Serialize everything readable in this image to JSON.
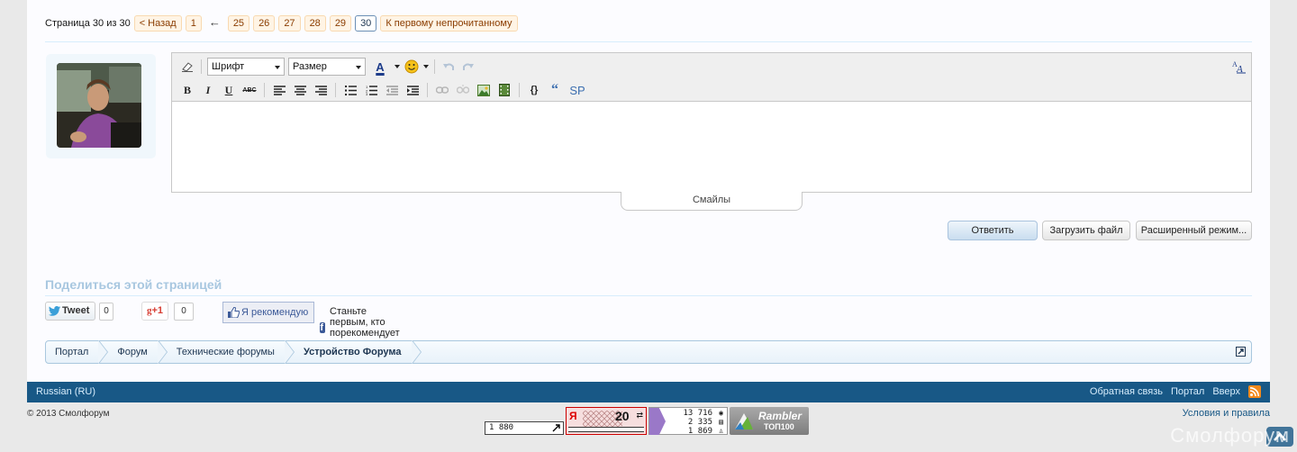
{
  "pagination": {
    "label": "Страница 30 из 30",
    "prev": "< Назад",
    "first": "1",
    "ellipsis_arrow": "←",
    "pages": [
      "25",
      "26",
      "27",
      "28",
      "29"
    ],
    "current": "30",
    "first_unread": "К первому непрочитанному"
  },
  "editor": {
    "font_select": "Шрифт",
    "size_select": "Размер",
    "text_color_letter": "A",
    "bold": "B",
    "italic": "I",
    "underline": "U",
    "strike": "ABC",
    "code_icon": "{}",
    "quote_icon": "“",
    "spoiler": "SP",
    "smilies_tab": "Смайлы"
  },
  "buttons": {
    "reply": "Ответить",
    "upload": "Загрузить файл",
    "advanced": "Расширенный режим..."
  },
  "share": {
    "title": "Поделиться этой страницей",
    "tweet": "Tweet",
    "tweet_count": "0",
    "gplus": "+1",
    "gplus_count": "0",
    "fb_recommend": "Я рекомендую",
    "fb_text": "Станьте первым, кто порекомендует это."
  },
  "breadcrumbs": [
    "Портал",
    "Форум",
    "Технические форумы",
    "Устройство Форума"
  ],
  "footer": {
    "language": "Russian (RU)",
    "links": [
      "Обратная связь",
      "Портал",
      "Вверх"
    ],
    "copyright": "© 2013 Смолфорум",
    "terms": "Условия и правила",
    "watermark": "Смолфорум"
  },
  "counters": {
    "li_count": "1 880",
    "yandex_letter": "Я",
    "yandex_value": "20",
    "stats": [
      "13 716",
      "2 335",
      "1 869"
    ],
    "rambler_name": "Rambler",
    "rambler_top": "ТОП100"
  },
  "colors": {
    "footer_bg": "#185886",
    "accent_link": "#185886",
    "pagenav_bg": "#fff4e5",
    "share_title": "#a8c7e0"
  }
}
